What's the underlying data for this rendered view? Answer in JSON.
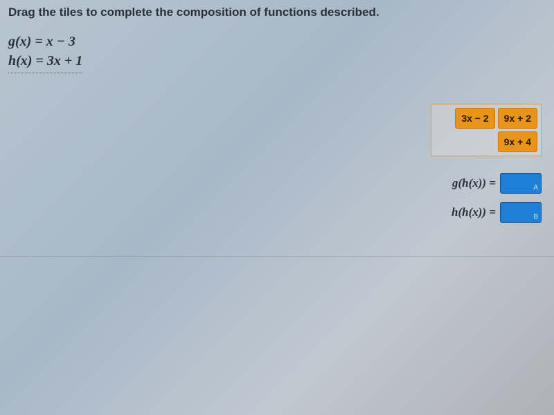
{
  "instruction": "Drag the tiles to complete the composition of functions described.",
  "functions": {
    "g": "g(x) = x − 3",
    "h": "h(x) = 3x + 1"
  },
  "tiles": [
    "3x − 2",
    "9x + 2",
    "9x + 4"
  ],
  "answers": [
    {
      "label": "g(h(x)) =",
      "slot": "A"
    },
    {
      "label": "h(h(x)) =",
      "slot": "B"
    }
  ]
}
